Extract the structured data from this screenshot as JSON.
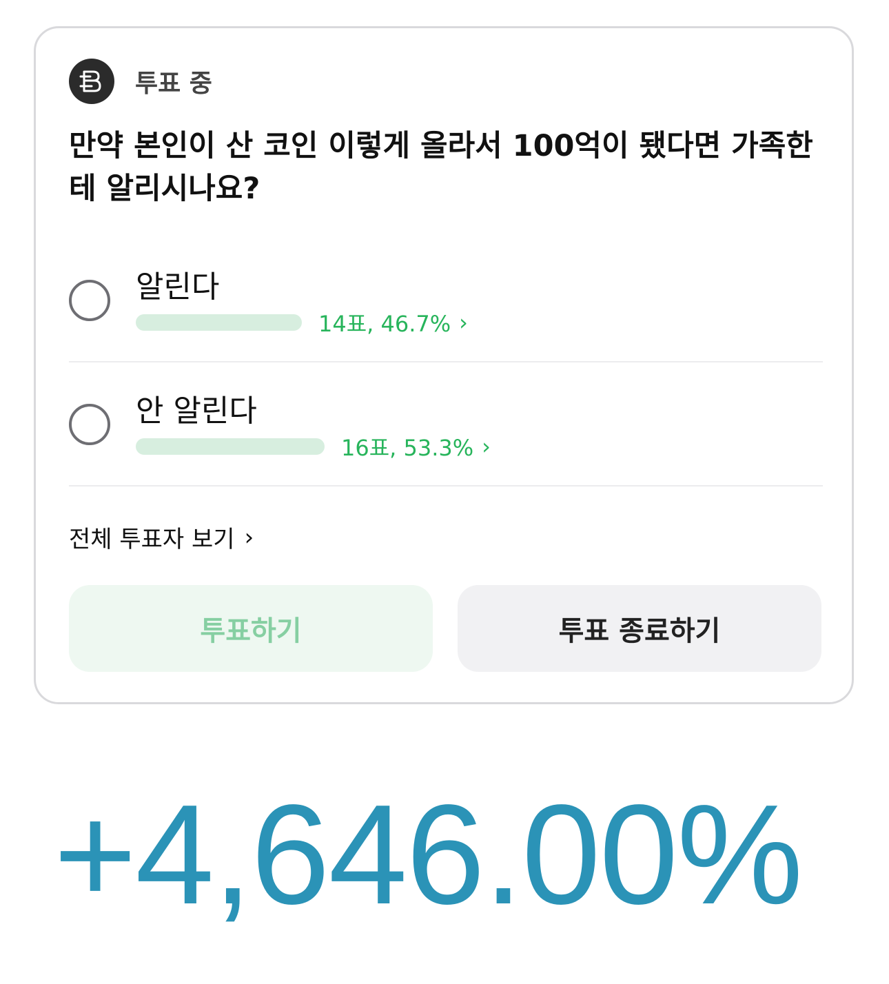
{
  "poll": {
    "status_label": "투표 중",
    "question": "만약 본인이 산 코인 이렇게 올라서 100억이 됐다면 가족한테 알리시나요?",
    "options": [
      {
        "label": "알린다",
        "result": "14표, 46.7%",
        "share": 0.467
      },
      {
        "label": "안 알린다",
        "result": "16표, 53.3%",
        "share": 0.533
      }
    ],
    "view_all_label": "전체 투표자 보기",
    "vote_button_label": "투표하기",
    "end_button_label": "투표 종료하기"
  },
  "icons": {
    "status": "ballot-badge-icon",
    "radio": "radio-unchecked-icon",
    "chevron": "chevron-right-icon"
  },
  "colors": {
    "accent_green": "#27b45b",
    "bar_fill": "#d7eedf",
    "big_number": "#2b93b7"
  },
  "overlay": {
    "big_number": "+4,646.00%"
  }
}
